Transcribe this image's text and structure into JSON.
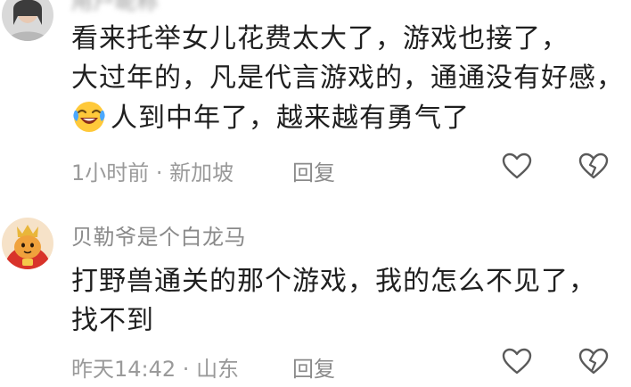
{
  "comments": [
    {
      "username": "用户昵称",
      "lines": [
        "看来托举女儿花费太大了，游戏也接了，",
        "大过年的，凡是代言游戏的，通通没有好感，",
        "人到中年了，越来越有勇气了"
      ],
      "emoji": "laughing-crying-emoji",
      "time": "1小时前",
      "location": "新加坡",
      "separator": " · ",
      "reply_label": "回复"
    },
    {
      "username": "贝勒爷是个白龙马",
      "lines": [
        "打野兽通关的那个游戏，我的怎么不见了，",
        "找不到"
      ],
      "time": "昨天14:42",
      "location": "山东",
      "separator": " · ",
      "reply_label": "回复"
    }
  ],
  "icons": {
    "like": "heart-outline-icon",
    "dislike": "broken-heart-icon"
  },
  "colors": {
    "text": "#1f1f1f",
    "meta": "#9a9a9a",
    "icon": "#5a5a5a"
  }
}
